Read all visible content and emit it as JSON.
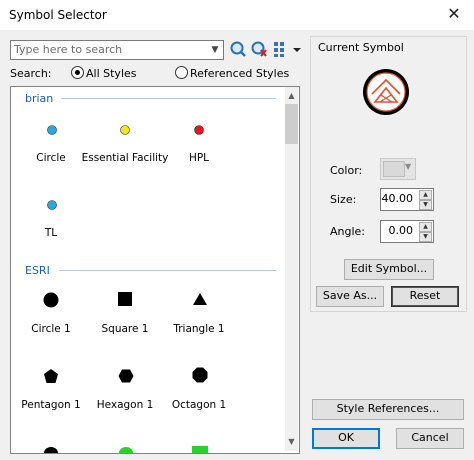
{
  "window": {
    "title": "Symbol Selector",
    "close_glyph": "✕"
  },
  "search": {
    "placeholder": "Type here to search",
    "value": ""
  },
  "search_options": {
    "label": "Search:",
    "all_styles": "All Styles",
    "referenced_styles": "Referenced Styles",
    "selected": "All Styles"
  },
  "groups": [
    {
      "name": "brian",
      "symbols": [
        {
          "label": "Circle",
          "color": "#29a8e0",
          "shape": "circle-small"
        },
        {
          "label": "Essential Facility",
          "color": "#f2e51a",
          "shape": "circle-small"
        },
        {
          "label": "HPL",
          "color": "#e8141c",
          "shape": "circle-small"
        },
        {
          "label": "TL",
          "color": "#29a8e0",
          "shape": "circle-small"
        }
      ]
    },
    {
      "name": "ESRI",
      "symbols": [
        {
          "label": "Circle 1",
          "color": "#000000",
          "shape": "circle"
        },
        {
          "label": "Square 1",
          "color": "#000000",
          "shape": "square"
        },
        {
          "label": "Triangle 1",
          "color": "#000000",
          "shape": "triangle"
        },
        {
          "label": "Pentagon 1",
          "color": "#000000",
          "shape": "pentagon"
        },
        {
          "label": "Hexagon 1",
          "color": "#000000",
          "shape": "hexagon"
        },
        {
          "label": "Octagon 1",
          "color": "#000000",
          "shape": "octagon"
        }
      ]
    }
  ],
  "current_symbol": {
    "heading": "Current Symbol",
    "color_label": "Color:",
    "size_label": "Size:",
    "size_value": "40.00",
    "angle_label": "Angle:",
    "angle_value": "0.00",
    "symbol_accent": "#e0512b"
  },
  "buttons": {
    "edit_symbol": "Edit Symbol...",
    "save_as": "Save As...",
    "reset": "Reset",
    "style_references": "Style References...",
    "ok": "OK",
    "cancel": "Cancel"
  },
  "icons": [
    "search-icon",
    "clear-search-icon",
    "view-options-icon"
  ]
}
